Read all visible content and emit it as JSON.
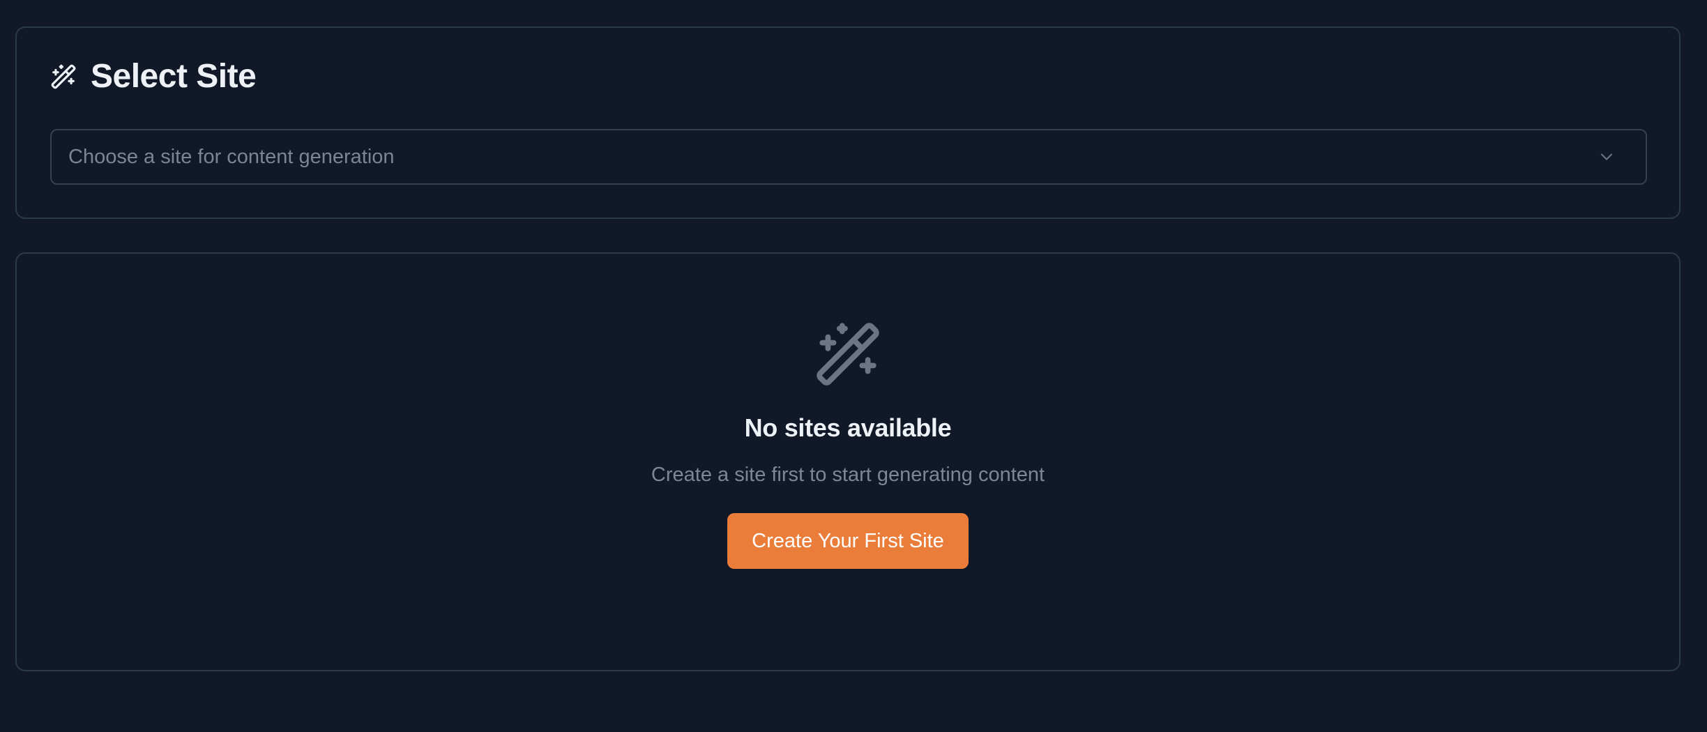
{
  "select_card": {
    "title": "Select Site",
    "title_icon": "wand-sparkles-icon",
    "select": {
      "placeholder": "Choose a site for content generation",
      "value": "",
      "icon": "chevron-down-icon"
    }
  },
  "empty_state": {
    "icon": "wand-sparkles-icon",
    "title": "No sites available",
    "description": "Create a site first to start generating content",
    "button_label": "Create Your First Site"
  },
  "colors": {
    "background": "#111827",
    "card_border": "#2b3a48",
    "text_primary": "#eef2f7",
    "text_muted": "#7a8595",
    "accent": "#ea7d39",
    "icon_muted": "#6b7585"
  }
}
